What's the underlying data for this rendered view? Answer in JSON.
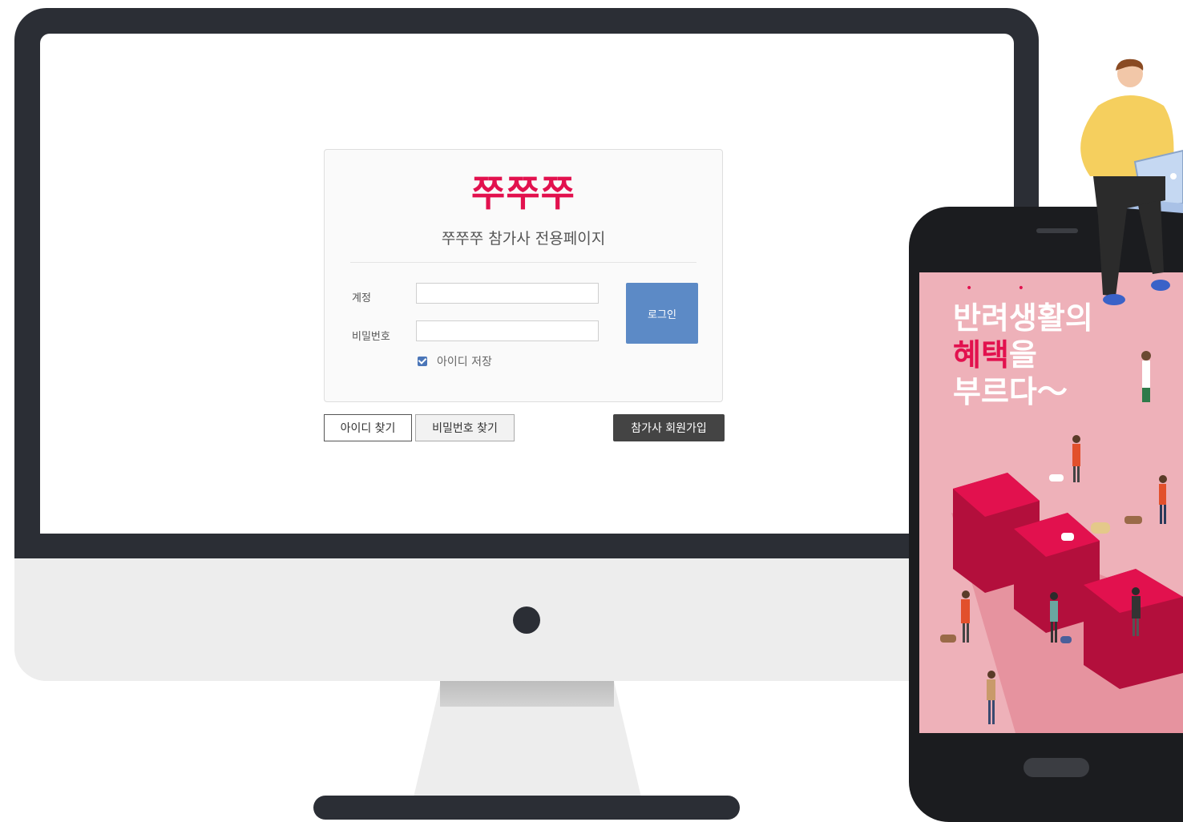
{
  "login": {
    "logo": "쭈쭈쭈",
    "subtitle": "쭈쭈쭈 참가사 전용페이지",
    "account_label": "계정",
    "password_label": "비밀번호",
    "account_value": "",
    "password_value": "",
    "login_button": "로그인",
    "remember_label": "아이디 저장",
    "remember_checked": true
  },
  "links": {
    "find_id": "아이디 찾기",
    "find_password": "비밀번호 찾기",
    "join": "참가사 회원가입"
  },
  "promo": {
    "line1": "반려생활의",
    "line2_accent": "혜택",
    "line2_rest": "을",
    "line3": "부르다～",
    "dots": "• •"
  },
  "colors": {
    "brand": "#e2114e",
    "login_button": "#5c8ac6",
    "join_button": "#444444",
    "promo_bg": "#eeb1b9",
    "device_dark": "#2b2e35"
  },
  "icons": {
    "checkbox": "checkbox-checked-icon"
  }
}
